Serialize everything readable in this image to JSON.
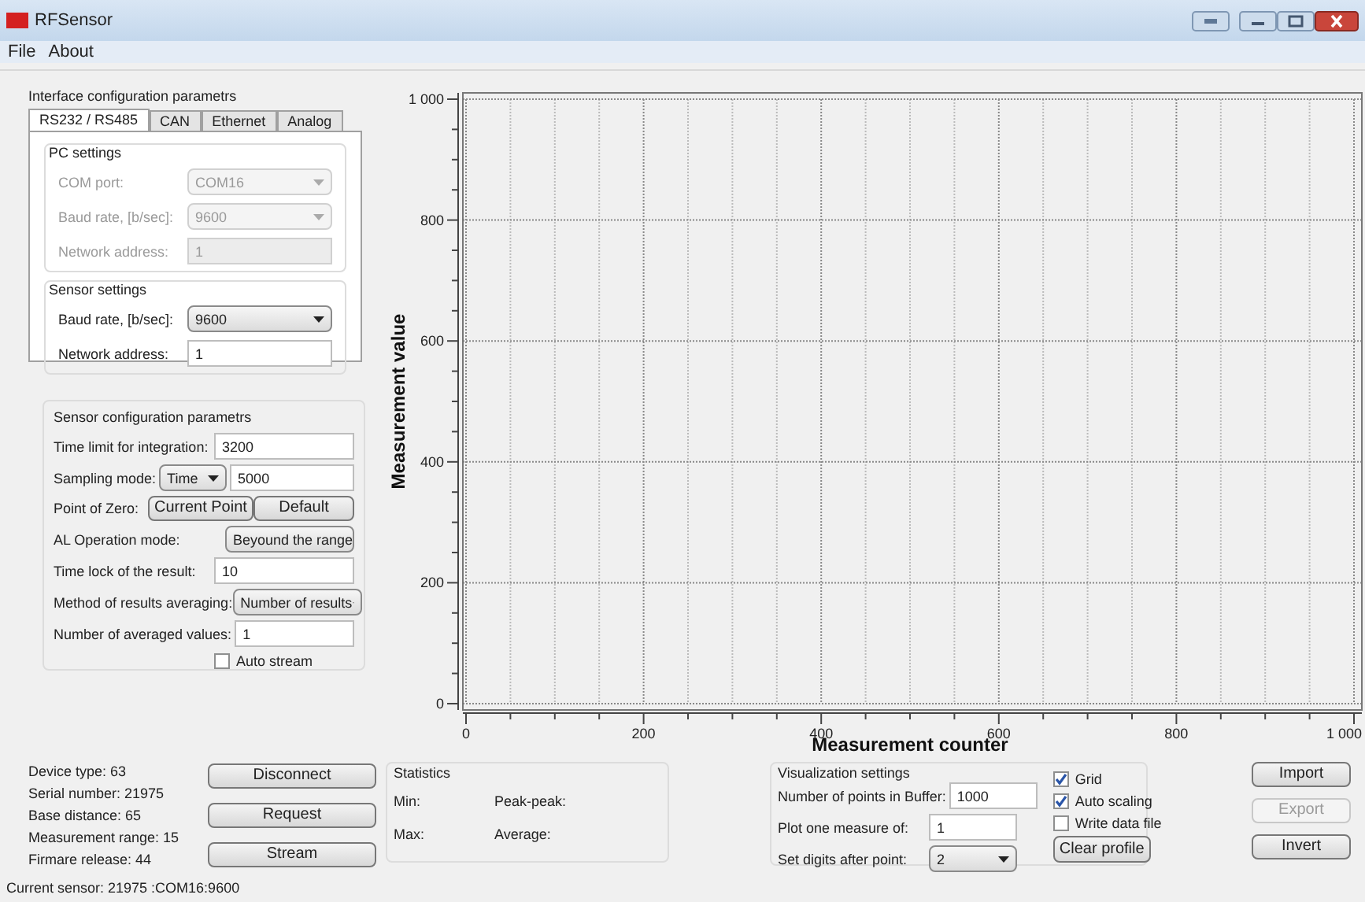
{
  "window": {
    "title": "RFSensor"
  },
  "menu": [
    {
      "label": "File"
    },
    {
      "label": "About"
    }
  ],
  "interface_config": {
    "title": "Interface configuration parametrs",
    "tabs": [
      {
        "label": "RS232 / RS485",
        "selected": true
      },
      {
        "label": "CAN",
        "selected": false
      },
      {
        "label": "Ethernet",
        "selected": false
      },
      {
        "label": "Analog",
        "selected": false
      }
    ],
    "groups": [
      {
        "title": "PC settings",
        "rows": [
          {
            "label": "COM port:",
            "value": "COM16",
            "kind": "dropdown",
            "disabled": true
          },
          {
            "label": "Baud rate, [b/sec]:",
            "value": "9600",
            "kind": "dropdown",
            "disabled": true
          },
          {
            "label": "Network address:",
            "value": "1",
            "kind": "field",
            "disabled": true
          }
        ]
      },
      {
        "title": "Sensor settings",
        "rows": [
          {
            "label": "Baud rate, [b/sec]:",
            "value": "9600",
            "kind": "dropdown",
            "disabled": false
          },
          {
            "label": "Network address:",
            "value": "1",
            "kind": "field",
            "disabled": false
          }
        ]
      }
    ]
  },
  "sensor_config": {
    "title": "Sensor configuration parametrs",
    "rows": [
      {
        "kind": "field",
        "label": "Time limit for integration:",
        "value": "3200"
      },
      {
        "kind": "dropdown_field",
        "label": "Sampling mode:",
        "option": "Time",
        "value": "5000"
      },
      {
        "kind": "buttons",
        "label": "Point of Zero:",
        "buttons": [
          "Current Point",
          "Default"
        ]
      },
      {
        "kind": "dropdown",
        "label": "AL Operation mode:",
        "value": "Beyound the range"
      },
      {
        "kind": "field",
        "label": "Time lock of the result:",
        "value": "10"
      },
      {
        "kind": "dropdown",
        "label": "Method of results averaging:",
        "value": "Number of results"
      },
      {
        "kind": "field",
        "label": "Number of averaged values:",
        "value": "1"
      },
      {
        "kind": "checkbox",
        "label": "Auto stream",
        "checked": false
      }
    ]
  },
  "chart": {
    "chart_data": {
      "type": "line",
      "grid": true,
      "xlabel": "Measurement counter",
      "ylabel": "Measurement value",
      "xlim": [
        0,
        1000
      ],
      "ylim": [
        0,
        1000
      ],
      "xticks": [
        0,
        200,
        400,
        600,
        800,
        {
          "value": 1000,
          "label": "1 000"
        }
      ],
      "yticks": [
        0,
        200,
        400,
        600,
        800,
        {
          "value": 1000,
          "label": "1 000"
        }
      ]
    }
  },
  "device_info": [
    "Device type: 63",
    "Serial number: 21975",
    "Base distance: 65",
    "Measurement range: 15",
    "Firmare release: 44"
  ],
  "device_buttons": [
    {
      "label": "Disconnect"
    },
    {
      "label": "Request"
    },
    {
      "label": "Stream"
    }
  ],
  "statistics": {
    "title": "Statistics",
    "items": [
      "Min:",
      "Peak-peak:",
      "Max:",
      "Average:"
    ]
  },
  "visualization": {
    "title": "Visualization settings",
    "fields": [
      {
        "label": "Number of points in Buffer:",
        "value": "1000",
        "kind": "field"
      },
      {
        "label": "Plot one measure of:",
        "value": "1",
        "kind": "field"
      },
      {
        "label": "Set digits after point:",
        "value": "2",
        "kind": "dropdown"
      }
    ],
    "checkboxes": [
      {
        "label": "Grid",
        "checked": true
      },
      {
        "label": "Auto scaling",
        "checked": true
      },
      {
        "label": "Write data file",
        "checked": false
      }
    ],
    "button": "Clear profile"
  },
  "action_buttons": [
    {
      "label": "Import",
      "disabled": false
    },
    {
      "label": "Export",
      "disabled": true
    },
    {
      "label": "Invert",
      "disabled": false
    }
  ],
  "status_bar": "Current sensor: 21975 :COM16:9600"
}
